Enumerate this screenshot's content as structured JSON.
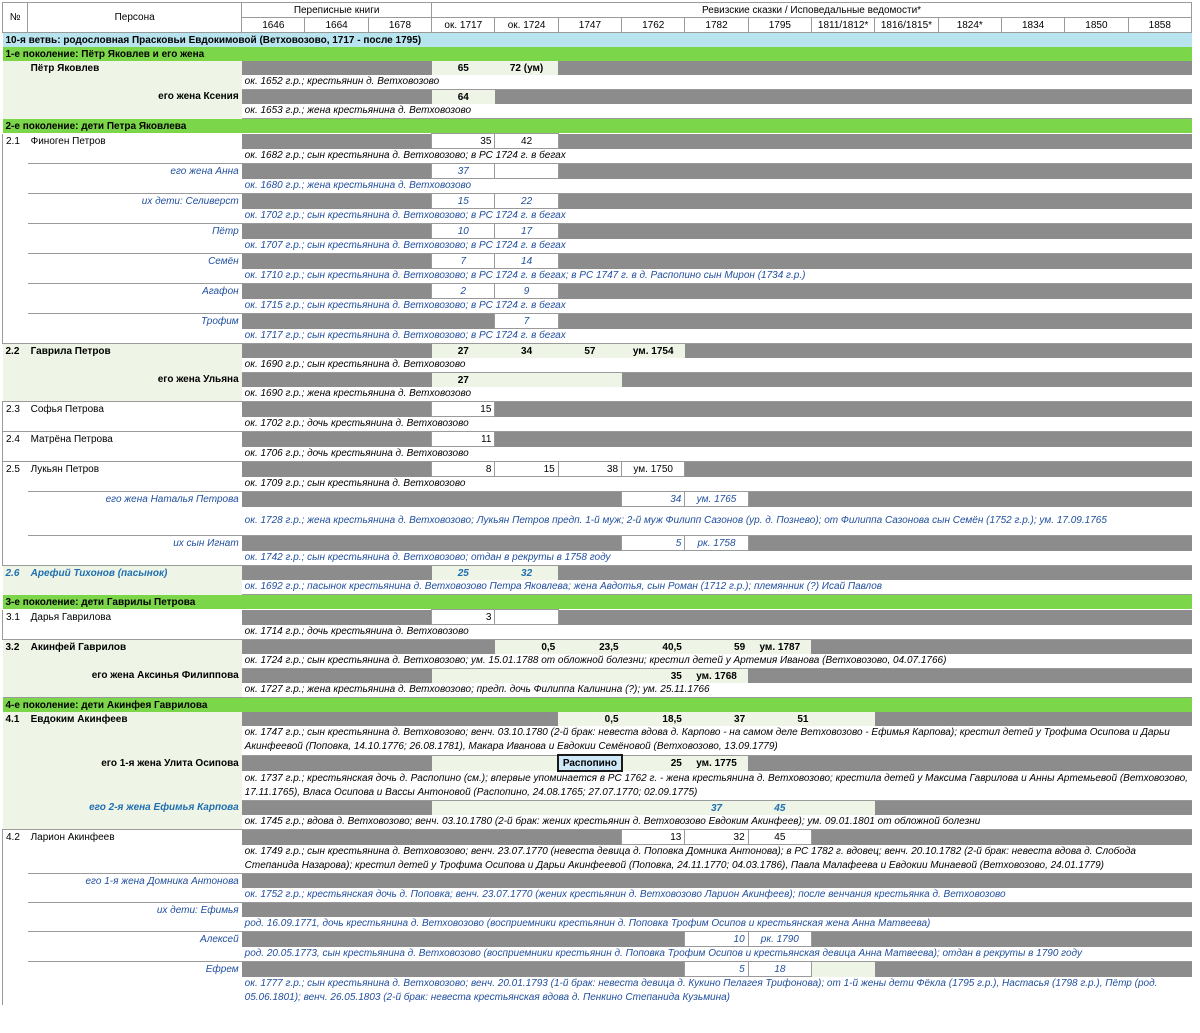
{
  "header": {
    "no": "№",
    "person": "Персона",
    "census_books": "Переписные книги",
    "revision_tales": "Ревизские сказки / Исповедальные ведомости*",
    "years": [
      "1646",
      "1664",
      "1678",
      "ок. 1717",
      "ок. 1724",
      "1747",
      "1762",
      "1782",
      "1795",
      "1811/1812*",
      "1816/1815*",
      "1824*",
      "1834",
      "1850",
      "1858"
    ]
  },
  "title": "10-я ветвь: родословная Прасковьи Евдокимовой (Ветховозово, 1717 - после 1795)",
  "gen1": "1-е поколение: Пётр Яковлев и его жена",
  "p1_name": "Пётр Яковлев",
  "p1_a": "65",
  "p1_b": "72 (ум)",
  "p1_note": "ок. 1652 г.р.; крестьянин д. Ветховозово",
  "p1w_name": "его жена Ксения",
  "p1w_a": "64",
  "p1w_note": "ок. 1653 г.р.; жена крестьянина д. Ветховозово",
  "gen2": "2-е поколение: дети Петра Яковлева",
  "r21_no": "2.1",
  "r21_name": "Финоген Петров",
  "r21_a": "35",
  "r21_b": "42",
  "r21_note": "ок. 1682 г.р.; сын крестьянина д. Ветховозово; в РС 1724 г. в бегах",
  "r21w_name": "его жена Анна",
  "r21w_a": "37",
  "r21w_note": "ок. 1680 г.р.; жена крестьянина д. Ветховозово",
  "r21c1_name": "их дети: Селиверст",
  "r21c1_a": "15",
  "r21c1_b": "22",
  "r21c1_note": "ок. 1702 г.р.; сын крестьянина д. Ветховозово; в РС 1724 г. в бегах",
  "r21c2_name": "Пётр",
  "r21c2_a": "10",
  "r21c2_b": "17",
  "r21c2_note": "ок. 1707 г.р.; сын крестьянина д. Ветховозово; в РС 1724 г. в бегах",
  "r21c3_name": "Семён",
  "r21c3_a": "7",
  "r21c3_b": "14",
  "r21c3_note": "ок. 1710 г.р.; сын крестьянина д. Ветховозово; в РС 1724 г. в бегах; в РС 1747 г. в д. Распопино сын Мирон (1734 г.р.)",
  "r21c4_name": "Агафон",
  "r21c4_a": "2",
  "r21c4_b": "9",
  "r21c4_note": "ок. 1715 г.р.; сын крестьянина д. Ветховозово; в РС 1724 г. в бегах",
  "r21c5_name": "Трофим",
  "r21c5_b": "7",
  "r21c5_note": "ок. 1717 г.р.; сын крестьянина д. Ветховозово; в РС 1724 г. в бегах",
  "r22_no": "2.2",
  "r22_name": "Гаврила Петров",
  "r22_a": "27",
  "r22_b": "34",
  "r22_c": "57",
  "r22_d": "ум. 1754",
  "r22_note": "ок. 1690 г.р.; сын крестьянина д. Ветховозово",
  "r22w_name": "его жена Ульяна",
  "r22w_a": "27",
  "r22w_note": "ок. 1690 г.р.; жена крестьянина д. Ветховозово",
  "r23_no": "2.3",
  "r23_name": "Софья Петрова",
  "r23_a": "15",
  "r23_note": "ок. 1702 г.р.; дочь крестьянина д. Ветховозово",
  "r24_no": "2.4",
  "r24_name": "Матрёна Петрова",
  "r24_a": "11",
  "r24_note": "ок. 1706 г.р.; дочь крестьянина д. Ветховозово",
  "r25_no": "2.5",
  "r25_name": "Лукьян Петров",
  "r25_a": "8",
  "r25_b": "15",
  "r25_c": "38",
  "r25_d": "ум. 1750",
  "r25_note": "ок. 1709 г.р.; сын крестьянина д. Ветховозово",
  "r25w_name": "его жена Наталья Петрова",
  "r25w_a": "34",
  "r25w_b": "ум. 1765",
  "r25w_note": "ок. 1728 г.р.; жена крестьянина д. Ветховозово; Лукьян Петров предп. 1-й муж; 2-й муж Филипп Сазонов (ур. д. Познево); от Филиппа Сазонова сын Семён (1752 г.р.); ум. 17.09.1765",
  "r25c_name": "их сын Игнат",
  "r25c_a": "5",
  "r25c_b": "рк. 1758",
  "r25c_note": "ок. 1742 г.р.; сын крестьянина д. Ветховозово; отдан в рекруты в 1758 году",
  "r26_no": "2.6",
  "r26_name": "Арефий Тихонов (пасынок)",
  "r26_a": "25",
  "r26_b": "32",
  "r26_note": "ок. 1692 г.р.; пасынок крестьянина д. Ветховозово Петра Яковлева; жена Авдотья, сын Роман (1712 г.р.); племянник (?) Исай Павлов",
  "gen3": "3-е поколение: дети Гаврилы Петрова",
  "r31_no": "3.1",
  "r31_name": "Дарья Гаврилова",
  "r31_a": "3",
  "r31_note": "ок. 1714 г.р.; дочь крестьянина д. Ветховозово",
  "r32_no": "3.2",
  "r32_name": "Акинфей Гаврилов",
  "r32_a": "0,5",
  "r32_b": "23,5",
  "r32_c": "40,5",
  "r32_d": "59",
  "r32_e": "ум. 1787",
  "r32_note": "ок. 1724 г.р.; сын крестьянина д. Ветховозово; ум. 15.01.1788 от обложной болезни; крестил детей у Артемия Иванова (Ветховозово, 04.07.1766)",
  "r32w_name": "его жена Аксинья Филиппова",
  "r32w_a": "35",
  "r32w_b": "ум. 1768",
  "r32w_note": "ок. 1727 г.р.; жена крестьянина д. Ветховозово; предп. дочь Филиппа Калинина (?); ум. 25.11.1766",
  "gen4": "4-е поколение: дети Акинфея Гаврилова",
  "r41_no": "4.1",
  "r41_name": "Евдоким Акинфеев",
  "r41_a": "0,5",
  "r41_b": "18,5",
  "r41_c": "37",
  "r41_d": "51",
  "r41_note": "ок. 1747 г.р.; сын крестьянина д. Ветховозово; венч. 03.10.1780 (2-й брак: невеста вдова д. Карпово - на самом деле Ветховозово - Ефимья Карпова); крестил детей у Трофима Осипова и Дарьи Акинфеевой (Поповка, 14.10.1776; 26.08.1781), Макара Иванова и Евдокии Семёновой (Ветховозово, 13.09.1779)",
  "r41w1_name": "его 1-я жена Улита Осипова",
  "r41w1_place": "Распопино",
  "r41w1_a": "25",
  "r41w1_b": "ум. 1775",
  "r41w1_note": "ок. 1737 г.р.; крестьянская дочь д. Распопино (см.); впервые упоминается в РС 1762 г. - жена крестьянина д. Ветховозово; крестила детей у Максима Гаврилова и Анны Артемьевой (Ветховозово, 17.11.1765), Власа Осипова и Вассы Антоновой (Распопино, 24.08.1765; 27.07.1770; 02.09.1775)",
  "r41w2_name": "его 2-я жена Ефимья Карпова",
  "r41w2_a": "37",
  "r41w2_b": "45",
  "r41w2_note": "ок. 1745 г.р.; вдова д. Ветховозово; венч. 03.10.1780 (2-й брак: жених крестьянин д. Ветховозово Евдоким Акинфеев); ум. 09.01.1801 от обложной болезни",
  "r42_no": "4.2",
  "r42_name": "Ларион Акинфеев",
  "r42_a": "13",
  "r42_b": "32",
  "r42_c": "45",
  "r42_note": "ок. 1749 г.р.; сын крестьянина д. Ветховозово; венч. 23.07.1770 (невеста девица д. Поповка Домника Антонова); в РС 1782 г. вдовец; венч. 20.10.1782 (2-й брак: невеста вдова д. Слобода Степанида Назарова); крестил детей у Трофима Осипова и Дарьи Акинфеевой (Поповка, 24.11.1770; 04.03.1786), Павла Малафеева и Евдокии Минаевой (Ветховозово, 24.01.1779)",
  "r42w_name": "его 1-я жена Домника Антонова",
  "r42w_note": "ок. 1752 г.р.; крестьянская дочь д. Поповка; венч. 23.07.1770 (жених крестьянин д. Ветховозово Ларион Акинфеев); после венчания крестьянка д. Ветховозово",
  "r42c1_name": "их дети: Ефимья",
  "r42c1_note": "род. 16.09.1771, дочь крестьянина д. Ветховозово (восприемники крестьянин д. Поповка Трофим Осипов и крестьянская жена Анна Матвеева)",
  "r42c2_name": "Алексей",
  "r42c2_a": "10",
  "r42c2_b": "рк. 1790",
  "r42c2_note": "род. 20.05.1773, сын крестьянина д. Ветховозово (восприемники крестьянин д. Поповка Трофим Осипов и крестьянская девица Анна Матвеева); отдан в рекруты в 1790 году",
  "r42c3_name": "Ефрем",
  "r42c3_a": "5",
  "r42c3_b": "18",
  "r42c3_note": "ок. 1777 г.р.; сын крестьянина д. Ветховозово; венч. 20.01.1793 (1-й брак: невеста девица д. Кукино Пелагея Трифонова); от 1-й жены дети Фёкла (1795 г.р.), Настасья (1798 г.р.), Пётр (род. 05.06.1801); венч. 26.05.1803 (2-й брак: невеста крестьянская вдова д. Пенкино Степанида Кузьмина)"
}
